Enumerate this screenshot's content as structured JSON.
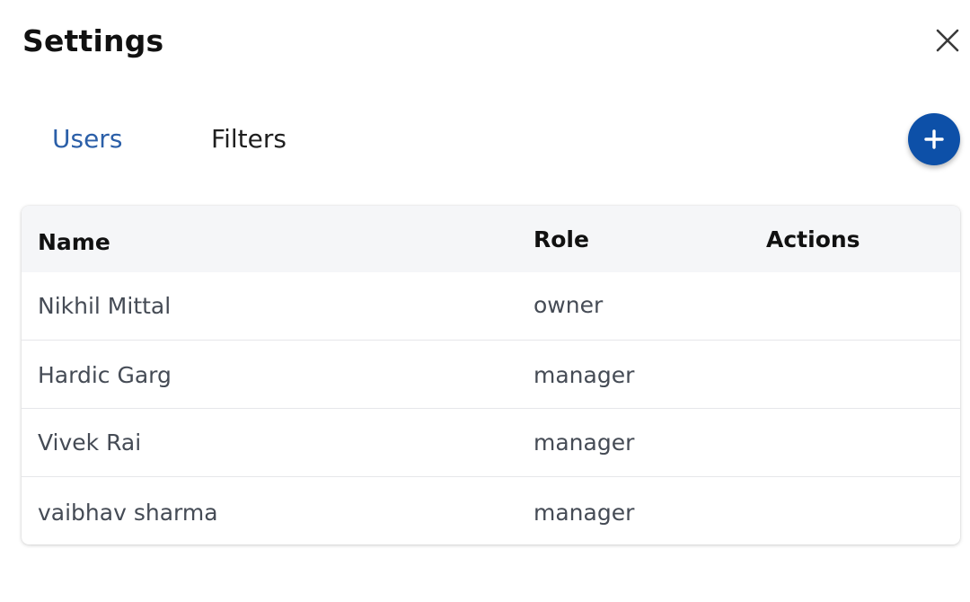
{
  "header": {
    "title": "Settings"
  },
  "tabs": [
    {
      "label": "Users",
      "active": true
    },
    {
      "label": "Filters",
      "active": false
    }
  ],
  "icons": {
    "close": "close-icon",
    "add": "plus-icon"
  },
  "colors": {
    "accent": "#2b5fa8",
    "add_button": "#0d50a8"
  },
  "table": {
    "columns": [
      "Name",
      "Role",
      "Actions"
    ],
    "rows": [
      {
        "name": "Nikhil Mittal",
        "role": "owner"
      },
      {
        "name": "Hardic Garg",
        "role": "manager"
      },
      {
        "name": "Vivek Rai",
        "role": "manager"
      },
      {
        "name": "vaibhav sharma",
        "role": "manager"
      }
    ]
  }
}
